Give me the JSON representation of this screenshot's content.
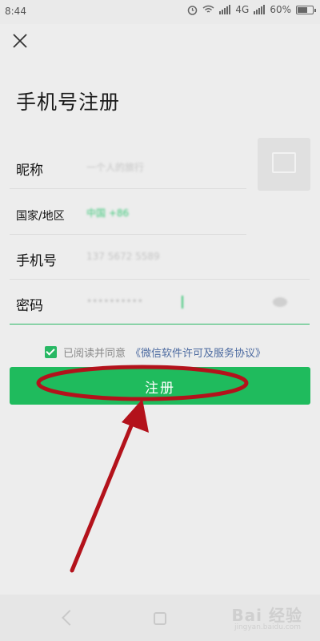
{
  "status_bar": {
    "time": "8:44",
    "network": "4G",
    "battery": "60%"
  },
  "page": {
    "title": "手机号注册"
  },
  "form": {
    "nickname": {
      "label": "昵称",
      "value": "一个人的旅行"
    },
    "country": {
      "label": "国家/地区",
      "value": "中国 +86"
    },
    "phone": {
      "label": "手机号",
      "value": "137 5672 5589"
    },
    "password": {
      "label": "密码",
      "value": "••••••••••"
    }
  },
  "agreement": {
    "text": "已阅读并同意",
    "link": "《微信软件许可及服务协议》"
  },
  "register_button": {
    "label": "注册"
  },
  "watermark": {
    "brand": "Bai 经验",
    "url": "jingyan.baidu.com"
  },
  "colors": {
    "accent": "#1fbb5d",
    "annotation": "#b3121b",
    "link": "#4c6aa0"
  }
}
